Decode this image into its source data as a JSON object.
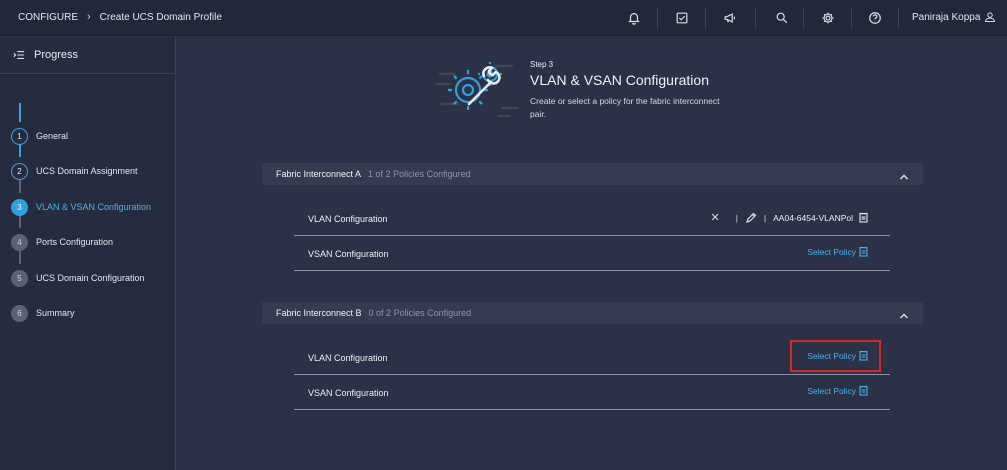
{
  "breadcrumb": {
    "root": "CONFIGURE",
    "current": "Create UCS Domain Profile"
  },
  "toolbar": {
    "icons": [
      "bell-icon",
      "checklist-icon",
      "megaphone-icon",
      "search-icon",
      "gear-icon",
      "help-icon",
      "user-icon"
    ],
    "user_name": "Paniraja Koppa"
  },
  "sidebar": {
    "title": "Progress",
    "steps": [
      {
        "num": "1",
        "label": "General",
        "state": "done"
      },
      {
        "num": "2",
        "label": "UCS Domain Assignment",
        "state": "done"
      },
      {
        "num": "3",
        "label": "VLAN & VSAN Configuration",
        "state": "active"
      },
      {
        "num": "4",
        "label": "Ports Configuration",
        "state": "pending"
      },
      {
        "num": "5",
        "label": "UCS Domain Configuration",
        "state": "pending"
      },
      {
        "num": "6",
        "label": "Summary",
        "state": "pending"
      }
    ]
  },
  "main": {
    "step_label": "Step 3",
    "title": "VLAN & VSAN Configuration",
    "description": "Create or select a policy for the fabric interconnect pair.",
    "fabric_a": {
      "name": "Fabric Interconnect A",
      "count": "1 of 2 Policies Configured",
      "rows": [
        {
          "label": "VLAN Configuration",
          "policy": "AA04-6454-VLANPol"
        },
        {
          "label": "VSAN Configuration",
          "action": "Select Policy"
        }
      ]
    },
    "fabric_b": {
      "name": "Fabric Interconnect B",
      "count": "0 of 2 Policies Configured",
      "rows": [
        {
          "label": "VLAN Configuration",
          "action": "Select Policy"
        },
        {
          "label": "VSAN Configuration",
          "action": "Select Policy"
        }
      ]
    }
  },
  "colors": {
    "accent": "#2ea0dc",
    "link": "#49b1ea",
    "highlight": "#d4262c",
    "background": "#2b3247"
  }
}
